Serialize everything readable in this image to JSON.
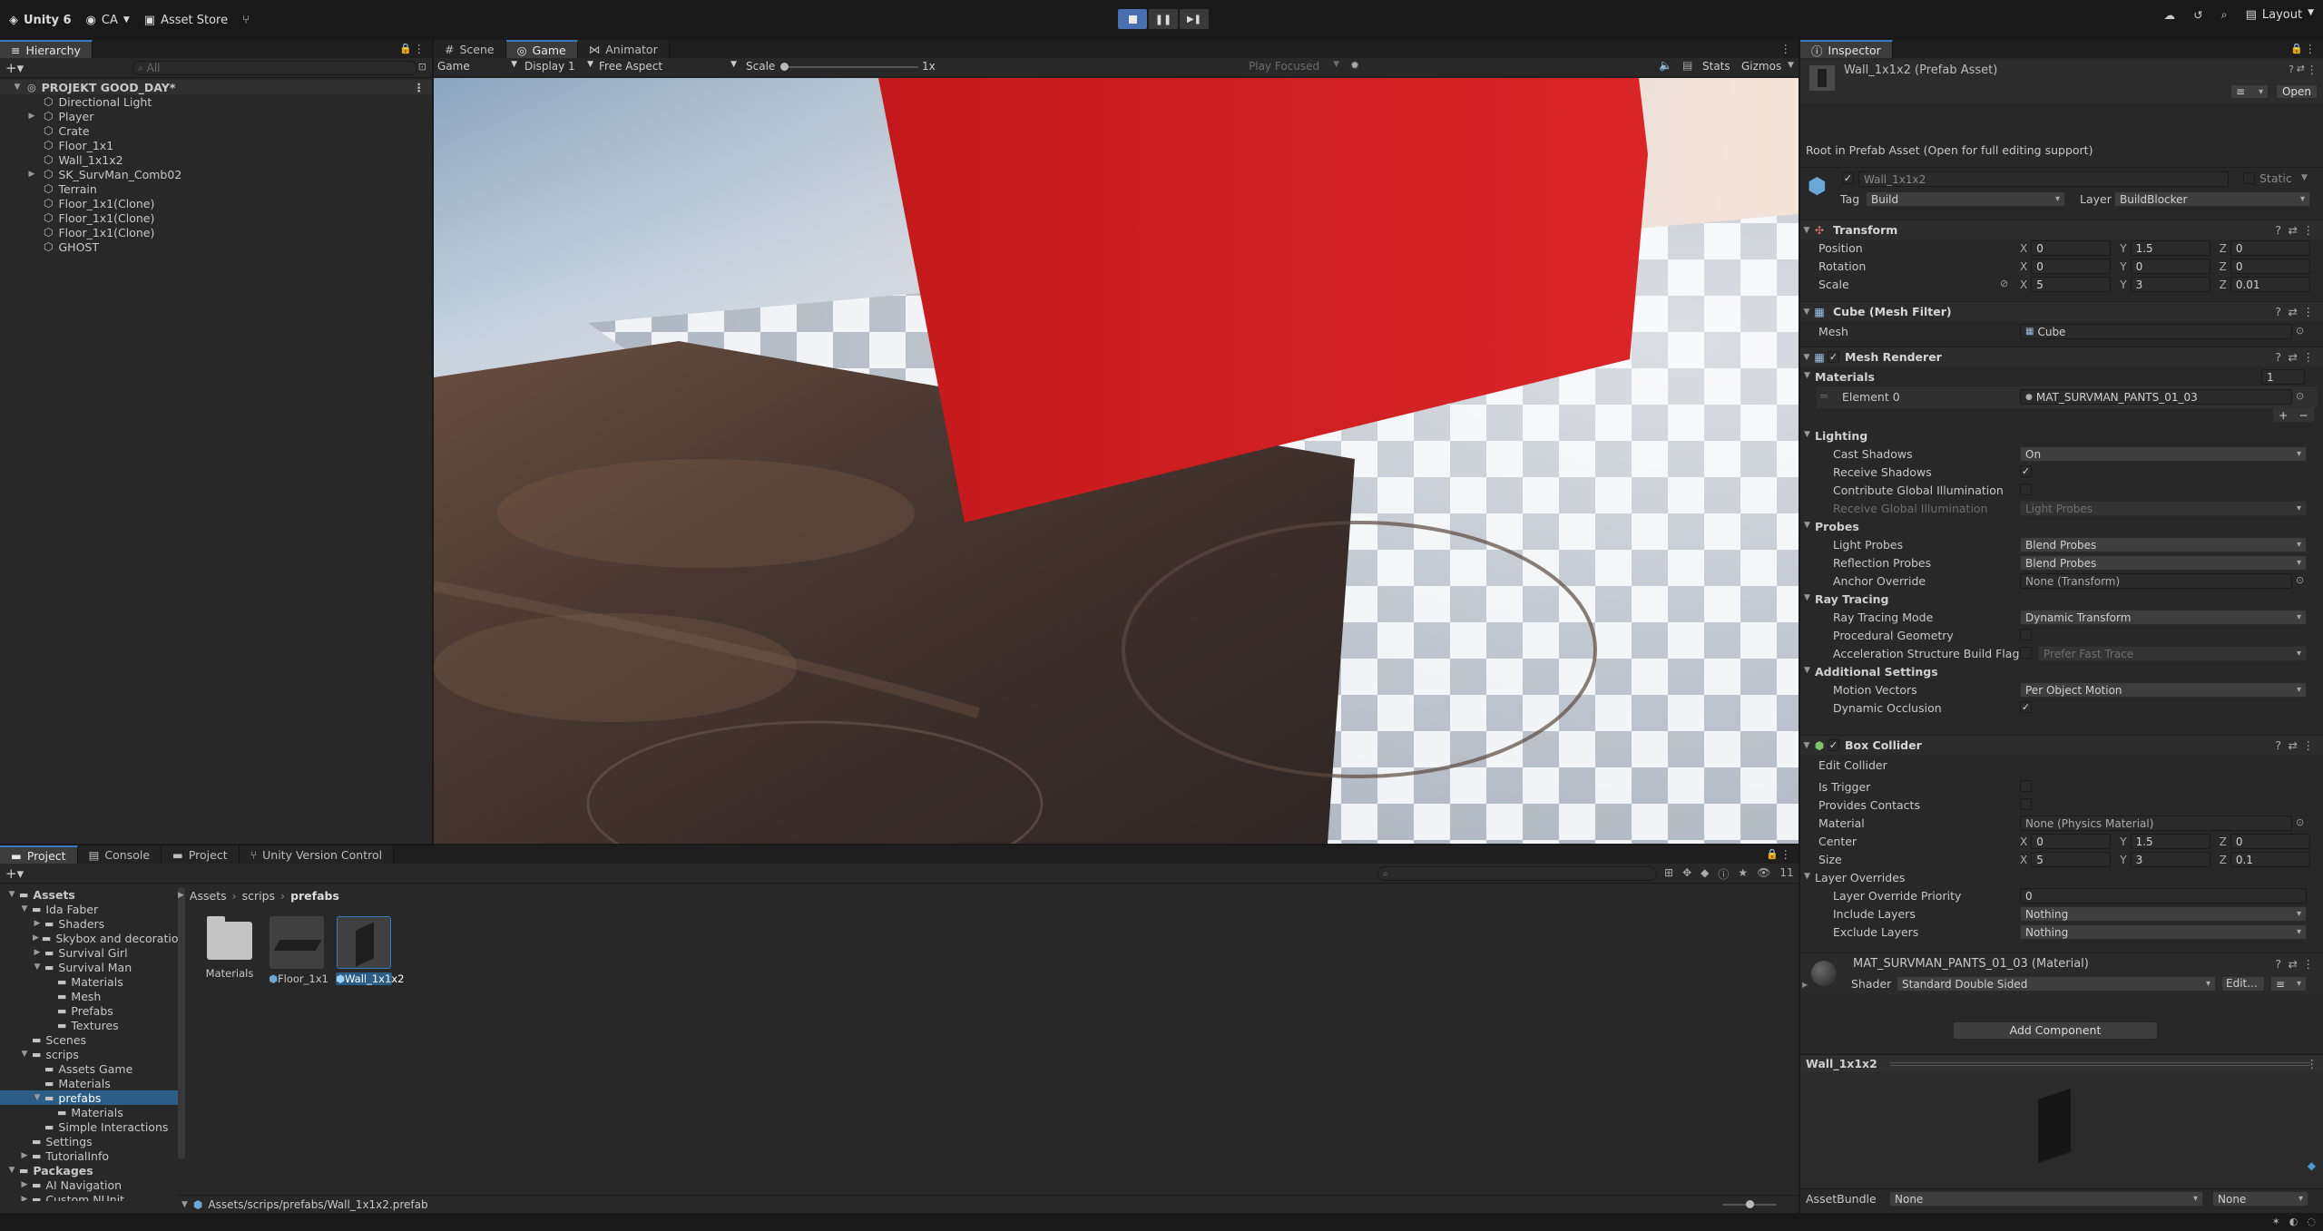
{
  "toolbar": {
    "app": "Unity 6",
    "account": "CA",
    "store": "Asset Store",
    "layout": "Layout"
  },
  "hierarchy": {
    "tab": "Hierarchy",
    "search_placeholder": "All",
    "scene": "PROJEKT GOOD_DAY*",
    "items": [
      "Directional Light",
      "Player",
      "Crate",
      "Floor_1x1",
      "Wall_1x1x2",
      "SK_SurvMan_Comb02",
      "Terrain",
      "Floor_1x1(Clone)",
      "Floor_1x1(Clone)",
      "Floor_1x1(Clone)",
      "GHOST"
    ]
  },
  "view": {
    "tabs": [
      "Scene",
      "Game",
      "Animator"
    ],
    "game_label": "Game",
    "display": "Display 1",
    "aspect": "Free Aspect",
    "scale_label": "Scale",
    "scale_value": "1x",
    "play_focused": "Play Focused",
    "stats": "Stats",
    "gizmos": "Gizmos"
  },
  "project": {
    "tabs": [
      "Project",
      "Console",
      "Project",
      "Unity Version Control"
    ],
    "count": "11",
    "tree": [
      {
        "label": "Assets",
        "depth": 0,
        "arrow": "open",
        "bold": true
      },
      {
        "label": "Ida Faber",
        "depth": 1,
        "arrow": "open"
      },
      {
        "label": "Shaders",
        "depth": 2,
        "arrow": "closed"
      },
      {
        "label": "Skybox and decoration",
        "depth": 2,
        "arrow": "closed"
      },
      {
        "label": "Survival Girl",
        "depth": 2,
        "arrow": "closed"
      },
      {
        "label": "Survival Man",
        "depth": 2,
        "arrow": "open"
      },
      {
        "label": "Materials",
        "depth": 3,
        "arrow": ""
      },
      {
        "label": "Mesh",
        "depth": 3,
        "arrow": ""
      },
      {
        "label": "Prefabs",
        "depth": 3,
        "arrow": ""
      },
      {
        "label": "Textures",
        "depth": 3,
        "arrow": ""
      },
      {
        "label": "Scenes",
        "depth": 1,
        "arrow": ""
      },
      {
        "label": "scrips",
        "depth": 1,
        "arrow": "open"
      },
      {
        "label": "Assets Game",
        "depth": 2,
        "arrow": ""
      },
      {
        "label": "Materials",
        "depth": 2,
        "arrow": ""
      },
      {
        "label": "prefabs",
        "depth": 2,
        "arrow": "open",
        "selected": true
      },
      {
        "label": "Materials",
        "depth": 3,
        "arrow": ""
      },
      {
        "label": "Simple Interactions",
        "depth": 2,
        "arrow": ""
      },
      {
        "label": "Settings",
        "depth": 1,
        "arrow": ""
      },
      {
        "label": "TutorialInfo",
        "depth": 1,
        "arrow": "closed"
      },
      {
        "label": "Packages",
        "depth": 0,
        "arrow": "open",
        "bold": true
      },
      {
        "label": "AI Navigation",
        "depth": 1,
        "arrow": "closed"
      },
      {
        "label": "Custom NUnit",
        "depth": 1,
        "arrow": "closed"
      }
    ],
    "breadcrumb": [
      "Assets",
      "scrips",
      "prefabs"
    ],
    "assets": [
      "Materials",
      "Floor_1x1",
      "Wall_1x1x2"
    ],
    "path": "Assets/scrips/prefabs/Wall_1x1x2.prefab"
  },
  "inspector": {
    "tab": "Inspector",
    "title": "Wall_1x1x2 (Prefab Asset)",
    "open": "Open",
    "root_note": "Root in Prefab Asset (Open for full editing support)",
    "name": "Wall_1x1x2",
    "static": "Static",
    "tag_label": "Tag",
    "tag": "Build",
    "layer_label": "Layer",
    "layer": "BuildBlocker",
    "transform": {
      "title": "Transform",
      "position": [
        "0",
        "1.5",
        "0"
      ],
      "rotation": [
        "0",
        "0",
        "0"
      ],
      "scale": [
        "5",
        "3",
        "0.01"
      ],
      "labels": {
        "position": "Position",
        "rotation": "Rotation",
        "scale": "Scale"
      }
    },
    "meshfilter": {
      "title": "Cube (Mesh Filter)",
      "mesh_label": "Mesh",
      "mesh": "Cube"
    },
    "renderer": {
      "title": "Mesh Renderer",
      "materials": "Materials",
      "count": "1",
      "element": "Element 0",
      "material": "MAT_SURVMAN_PANTS_01_03",
      "lighting": "Lighting",
      "cast_shadows_label": "Cast Shadows",
      "cast_shadows": "On",
      "receive_shadows": "Receive Shadows",
      "contribute_gi": "Contribute Global Illumination",
      "receive_gi": "Receive Global Illumination",
      "receive_gi_val": "Light Probes",
      "probes": "Probes",
      "light_probes_label": "Light Probes",
      "light_probes": "Blend Probes",
      "reflection_label": "Reflection Probes",
      "reflection": "Blend Probes",
      "anchor_label": "Anchor Override",
      "anchor": "None (Transform)",
      "raytracing": "Ray Tracing",
      "rt_mode_label": "Ray Tracing Mode",
      "rt_mode": "Dynamic Transform",
      "procedural": "Procedural Geometry",
      "accel_label": "Acceleration Structure Build Flags",
      "accel": "Prefer Fast Trace",
      "additional": "Additional Settings",
      "motion_label": "Motion Vectors",
      "motion": "Per Object Motion",
      "dyn_occl": "Dynamic Occlusion"
    },
    "collider": {
      "title": "Box Collider",
      "edit": "Edit Collider",
      "trigger": "Is Trigger",
      "contacts": "Provides Contacts",
      "material_label": "Material",
      "material": "None (Physics Material)",
      "center_label": "Center",
      "center": [
        "0",
        "1.5",
        "0"
      ],
      "size_label": "Size",
      "size": [
        "5",
        "3",
        "0.1"
      ],
      "overrides": "Layer Overrides",
      "priority_label": "Layer Override Priority",
      "priority": "0",
      "include_label": "Include Layers",
      "include": "Nothing",
      "exclude_label": "Exclude Layers",
      "exclude": "Nothing"
    },
    "material": {
      "title": "MAT_SURVMAN_PANTS_01_03 (Material)",
      "shader_label": "Shader",
      "shader": "Standard Double Sided",
      "edit": "Edit..."
    },
    "add_component": "Add Component",
    "preview_title": "Wall_1x1x2",
    "assetbundle_label": "AssetBundle",
    "assetbundle": "None",
    "assetbundle_variant": "None"
  },
  "colors": {
    "accent": "#3a79bb",
    "wall": "#c81d1f",
    "selected": "#2c5d87"
  }
}
